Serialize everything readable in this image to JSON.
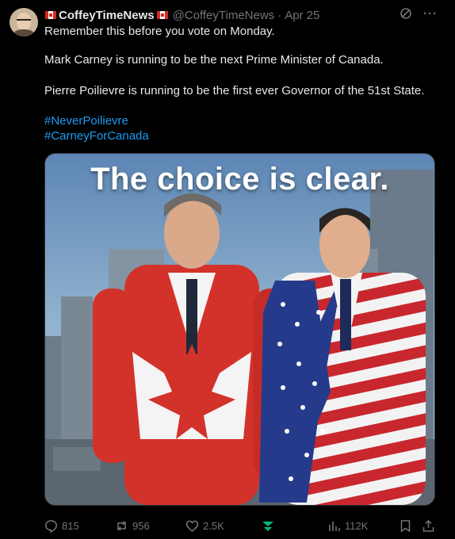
{
  "author": {
    "display_name": "CoffeyTimeNews",
    "handle": "@CoffeyTimeNews",
    "date": "Apr 25"
  },
  "post": {
    "line1": "Remember this before you vote on Monday.",
    "line2": "Mark Carney is running to be the next Prime Minister of Canada.",
    "line3": "Pierre Poilievre is running to be the first ever Governor of the 51st State.",
    "hashtag1": "#NeverPoilievre",
    "hashtag2": "#CarneyForCanada"
  },
  "media": {
    "headline": "The choice is clear."
  },
  "actions": {
    "replies": "815",
    "reposts": "956",
    "likes": "2.5K",
    "views": "112K"
  },
  "colors": {
    "link": "#1d9bf0",
    "muted": "#71767b",
    "canada_red": "#d52b1e"
  }
}
